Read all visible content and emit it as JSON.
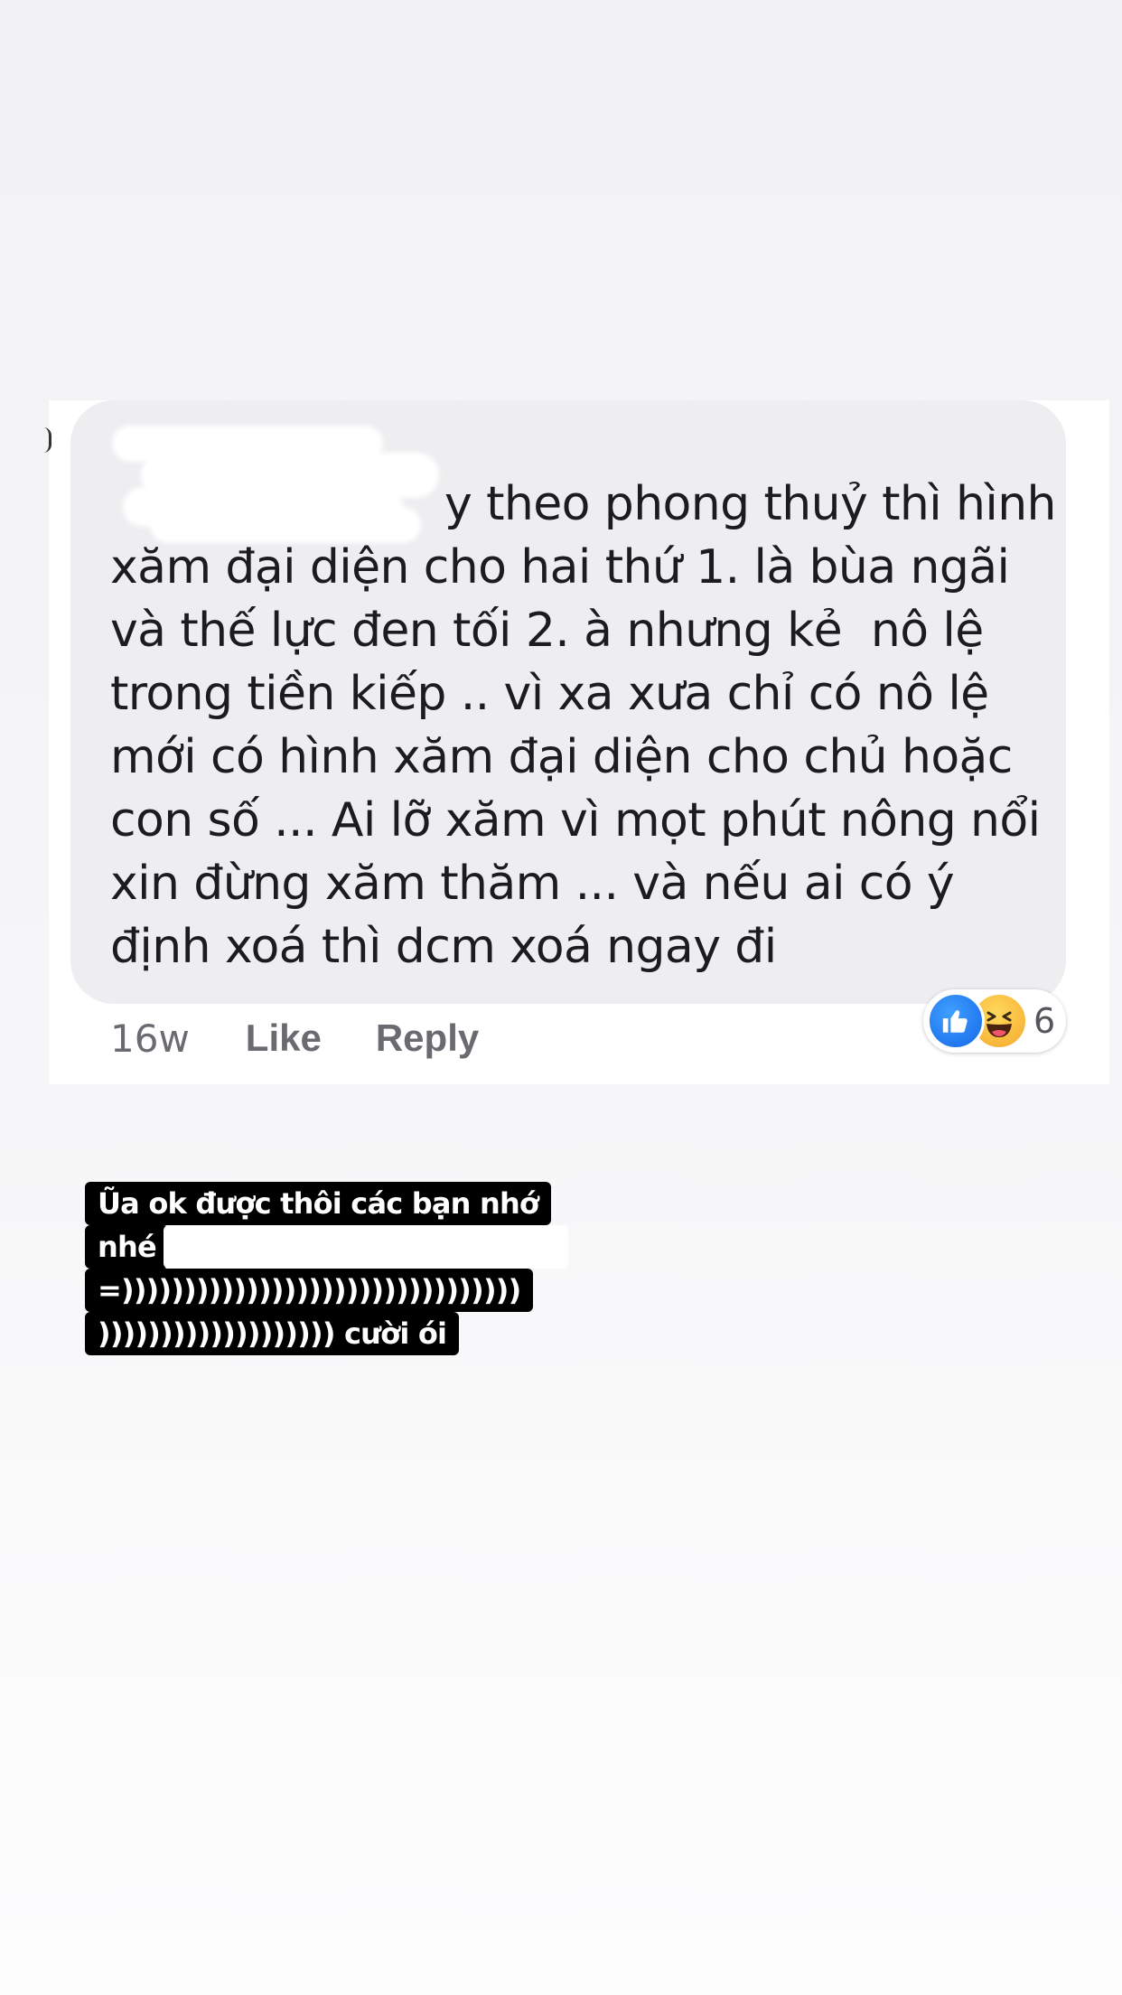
{
  "comment": {
    "lines": [
      "y theo phong thuỷ thì hình",
      "xăm đại diện cho hai thứ 1. là bùa ngãi",
      "và thế lực đen tối 2. à nhưng kẻ  nô lệ",
      "trong tiền kiếp .. vì xa xưa chỉ có nô lệ",
      "mới có hình xăm đại diện cho chủ hoặc",
      "con số ... Ai lỡ xăm vì mọt phút nông nổi",
      "xin đừng xăm thăm ... và nếu ai có ý",
      "định xoá thì dcm xoá ngay đi"
    ],
    "author": ""
  },
  "actions": {
    "time": "16w",
    "like_label": "Like",
    "reply_label": "Reply"
  },
  "reactions": {
    "icons": [
      "like-icon",
      "haha-icon"
    ],
    "count": "6",
    "like_color": "#1877f2",
    "haha_color": "#f7b928"
  },
  "caption": {
    "lines": [
      "Ũa ok được thôi các bạn nhớ",
      "nhé",
      "=))))))))))))))))))))))))))))))))",
      "))))))))))))))))))) cười ói"
    ]
  }
}
